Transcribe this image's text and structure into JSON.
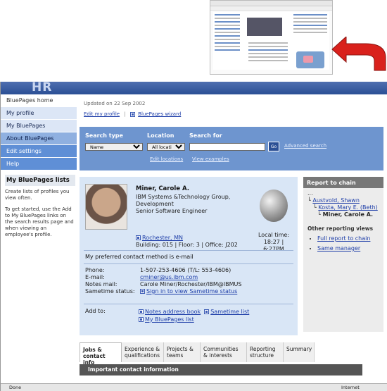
{
  "sidebar": {
    "items": [
      {
        "label": "BluePages home"
      },
      {
        "label": "My profile"
      },
      {
        "label": "My BluePages"
      },
      {
        "label": "About BluePages"
      },
      {
        "label": "Edit settings"
      },
      {
        "label": "Help"
      }
    ],
    "lists_heading": "My BluePages lists",
    "lists_text_1": "Create lists of profiles you view often.",
    "lists_text_2": "To get started, use the Add to My BluePages links on the search results page and when viewing an employee's profile."
  },
  "header": {
    "updated": "Updated on 22 Sep 2002",
    "edit_profile": "Edit my profile",
    "wizard": "BluePages wizard"
  },
  "search": {
    "type_label": "Search type",
    "location_label": "Location",
    "for_label": "Search for",
    "type_value": "Name",
    "location_value": "All locations",
    "go_label": "Go",
    "advanced": "Advanced search",
    "edit_locations": "Edit locations",
    "view_examples": "View examples"
  },
  "profile": {
    "name": "Miner, Carole A.",
    "line1": "IBM Systems &Technology Group,",
    "line2": "Development",
    "line3": "Senior Software Engineer",
    "location": "Rochester, MN",
    "building": "Building: 015 | Floor: 3 | Office: J202",
    "local_time_label": "Local time:",
    "local_time_value": "18:27 |",
    "local_time_value2": "6:27PM",
    "preferred": "My preferred contact method is e-mail",
    "contact": {
      "phone_label": "Phone:",
      "phone_value": "1-507-253-4606 (T/L: 553-4606)",
      "email_label": "E-mail:",
      "email_value": "cminer@us.ibm.com",
      "notes_label": "Notes mail:",
      "notes_value": "Carole Miner/Rochester/IBM@IBMUS",
      "sametime_label": "Sametime status:",
      "sametime_value": "Sign in to view Sametime status"
    },
    "add_to_label": "Add to:",
    "add_notes": "Notes address book",
    "add_sametime": "Sametime list",
    "add_bluepages": "My BluePages list"
  },
  "chain": {
    "title": "Report to chain",
    "dots": "...",
    "p1": "Austvold, Shawn",
    "p2": "Kosta, Mary E. (Beth)",
    "p3": "Miner, Carole A.",
    "other": "Other reporting views",
    "full": "Full report to chain",
    "same": "Same manager"
  },
  "tabs": [
    {
      "label": "Jobs & contact info"
    },
    {
      "label": "Experience & qualifications"
    },
    {
      "label": "Projects & teams"
    },
    {
      "label": "Communities & interests"
    },
    {
      "label": "Reporting structure"
    },
    {
      "label": "Summary"
    }
  ],
  "section": {
    "important": "Important contact information"
  },
  "status": {
    "done": "Done",
    "zone": "Internet"
  },
  "colors": {
    "accent": "#6e95cf",
    "card": "#d9e6f6",
    "arrow": "#d9211c"
  }
}
